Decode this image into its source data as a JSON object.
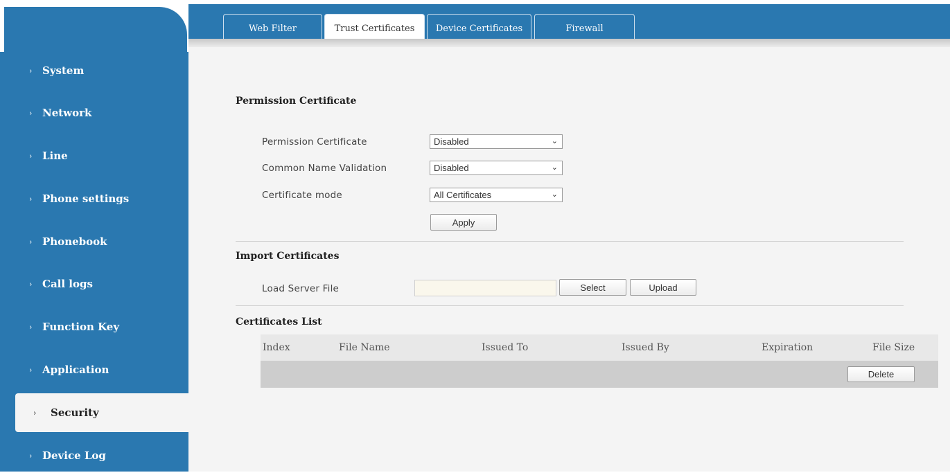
{
  "sidebar": {
    "items": [
      {
        "label": "System"
      },
      {
        "label": "Network"
      },
      {
        "label": "Line"
      },
      {
        "label": "Phone settings"
      },
      {
        "label": "Phonebook"
      },
      {
        "label": "Call logs"
      },
      {
        "label": "Function Key"
      },
      {
        "label": "Application"
      },
      {
        "label": "Security",
        "active": true
      },
      {
        "label": "Device Log"
      }
    ],
    "chevron": "›"
  },
  "tabs": [
    {
      "label": "Web Filter"
    },
    {
      "label": "Trust Certificates",
      "active": true
    },
    {
      "label": "Device Certificates"
    },
    {
      "label": "Firewall"
    }
  ],
  "permission": {
    "title": "Permission Certificate",
    "fields": [
      {
        "label": "Permission Certificate",
        "value": "Disabled"
      },
      {
        "label": "Common Name Validation",
        "value": "Disabled"
      },
      {
        "label": "Certificate mode",
        "value": "All Certificates"
      }
    ],
    "apply_label": "Apply"
  },
  "import": {
    "title": "Import Certificates",
    "load_label": "Load Server File",
    "file_value": "",
    "select_label": "Select",
    "upload_label": "Upload"
  },
  "certs": {
    "title": "Certificates List",
    "columns": [
      "Index",
      "File Name",
      "Issued To",
      "Issued By",
      "Expiration",
      "File Size"
    ],
    "delete_label": "Delete"
  },
  "colors": {
    "accent": "#2a78b0",
    "content_bg": "#f4f4f4"
  }
}
